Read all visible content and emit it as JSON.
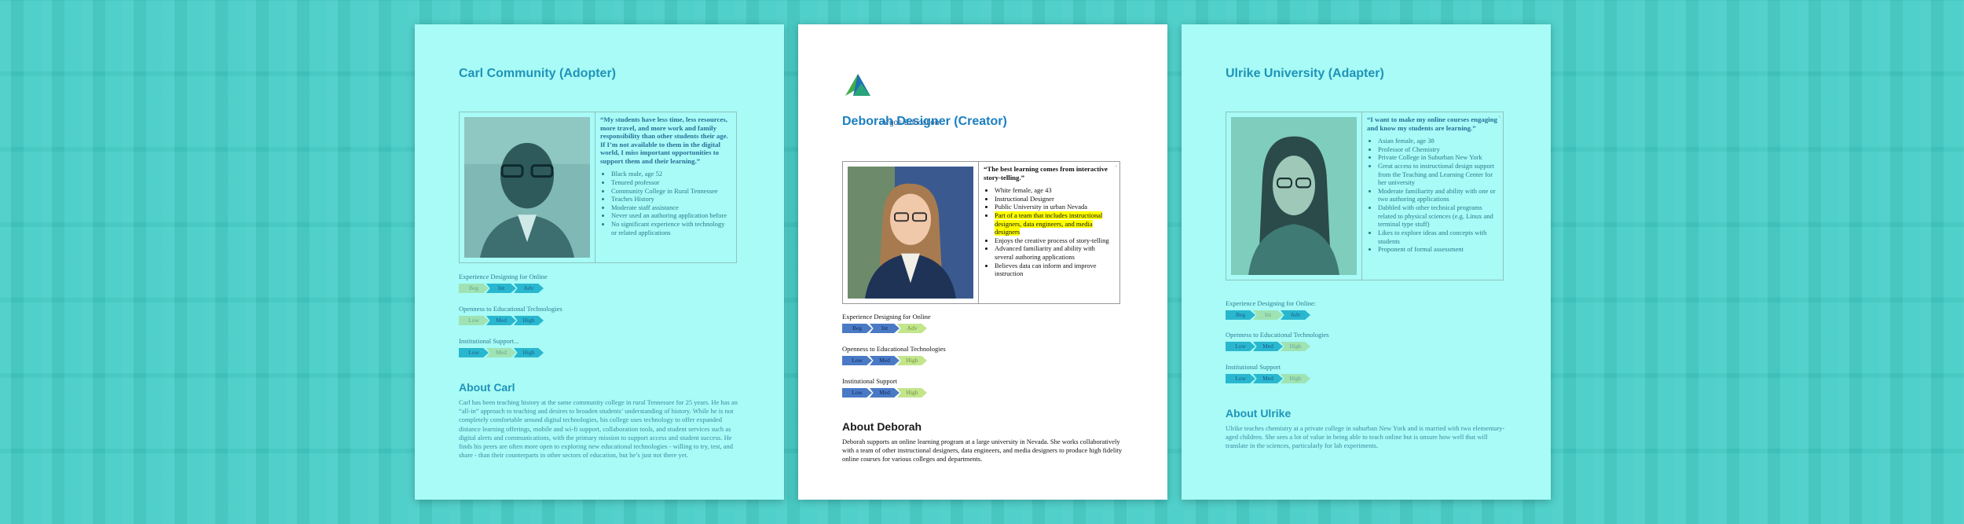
{
  "pages": [
    {
      "title": "Carl Community (Adopter)",
      "quote": "“My students have less time, less resources, more travel, and more work and family responsibility than other students their age. If I’m not available to them in the digital world, I miss important opportunities to support them and their learning.”",
      "bullets": [
        "Black male, age 52",
        "Tenured professor",
        "Community College in Rural Tennessee",
        "Teaches History",
        "Moderate staff assistance",
        "Never used an authoring application before",
        "No significant experience with technology or related applications"
      ],
      "scales": [
        {
          "label": "Experience Designing for Online",
          "levels": [
            "Beg",
            "Int",
            "Adv"
          ],
          "selected": 0
        },
        {
          "label": "Openness to Educational Technologies",
          "levels": [
            "Low",
            "Med",
            "High"
          ],
          "selected": 0
        },
        {
          "label": "Institutional Support",
          "levels": [
            "Low",
            "Med",
            "High"
          ],
          "selected": 1
        }
      ],
      "about_title": "About Carl",
      "about_text": "Carl has been teaching history at the same community college in rural Tennessee for 25 years. He has an “all-in” approach to teaching and desires to broaden students’ understanding of history. While he is not completely comfortable around digital technologies, his college uses technology to offer expanded distance learning offerings, mobile and wi-fi support, collaboration tools, and student services such as digital alerts and communications, with the primary mission to support access and student success. He finds his peers are often more open to exploring new educational technologies - willing to try, test, and share - than their counterparts in other sectors of education, but he’s just not there yet."
    },
    {
      "brand": "Argos Education",
      "title": "Deborah Designer (Creator)",
      "quote": "“The best learning comes from interactive story-telling.”",
      "bullets": [
        "White female, age 43",
        "Instructional Designer",
        "Public University in urban Nevada",
        "Part of a team that includes instructional designers, data engineers, and media designers",
        "Enjoys the creative process of story-telling",
        "Advanced familiarity and ability with several authoring applications",
        "Believes data can inform and improve instruction"
      ],
      "highlight_index": 3,
      "scales": [
        {
          "label": "Experience Designing for Online",
          "levels": [
            "Beg",
            "Int",
            "Adv"
          ],
          "selected": 2
        },
        {
          "label": "Openness to Educational Technologies",
          "levels": [
            "Low",
            "Med",
            "High"
          ],
          "selected": 2
        },
        {
          "label": "Institutional Support",
          "levels": [
            "Low",
            "Med",
            "High"
          ],
          "selected": 2
        }
      ],
      "about_title": "About Deborah",
      "about_text": "Deborah supports an online learning program at a large university in Nevada. She works collaboratively with a team of other instructional designers, data engineers, and media designers to produce high fidelity online courses for various colleges and departments."
    },
    {
      "title": "Ulrike University (Adapter)",
      "quote": "“I want to make my online courses engaging and know my students are learning.”",
      "bullets": [
        "Asian female, age 38",
        "Professor of Chemistry",
        "Private College in Suburban New York",
        "Great access to instructional design support from the Teaching and Learning Center for her university",
        "Moderate familiarity and ability with one or two authoring applications",
        "Dabbled with other technical programs related to physical sciences (e.g. Linux and terminal type stuff)",
        "Likes to explore ideas and concepts with students",
        "Proponent of formal assessment"
      ],
      "scales": [
        {
          "label": "Experience Designing for Online",
          "levels": [
            "Beg",
            "Int",
            "Adv"
          ],
          "selected": 1
        },
        {
          "label": "Openness to Educational Technologies",
          "levels": [
            "Low",
            "Med",
            "High"
          ],
          "selected": 2
        },
        {
          "label": "Institutional Support",
          "levels": [
            "Low",
            "Med",
            "High"
          ],
          "selected": 2
        }
      ],
      "about_title": "About Ulrike",
      "about_text": "Ulrike teaches chemistry at a private college in suburban New York and is married with two elementary-aged children. She sees a lot of value in being able to teach online but is unsure how well that will translate in the sciences, particularly for lab experiments."
    }
  ],
  "colors": {
    "cyan_page": "#a8fbf6",
    "title_blue": "#1f93b8",
    "highlight": "#ffff00",
    "brand_green": "#3fae49"
  }
}
